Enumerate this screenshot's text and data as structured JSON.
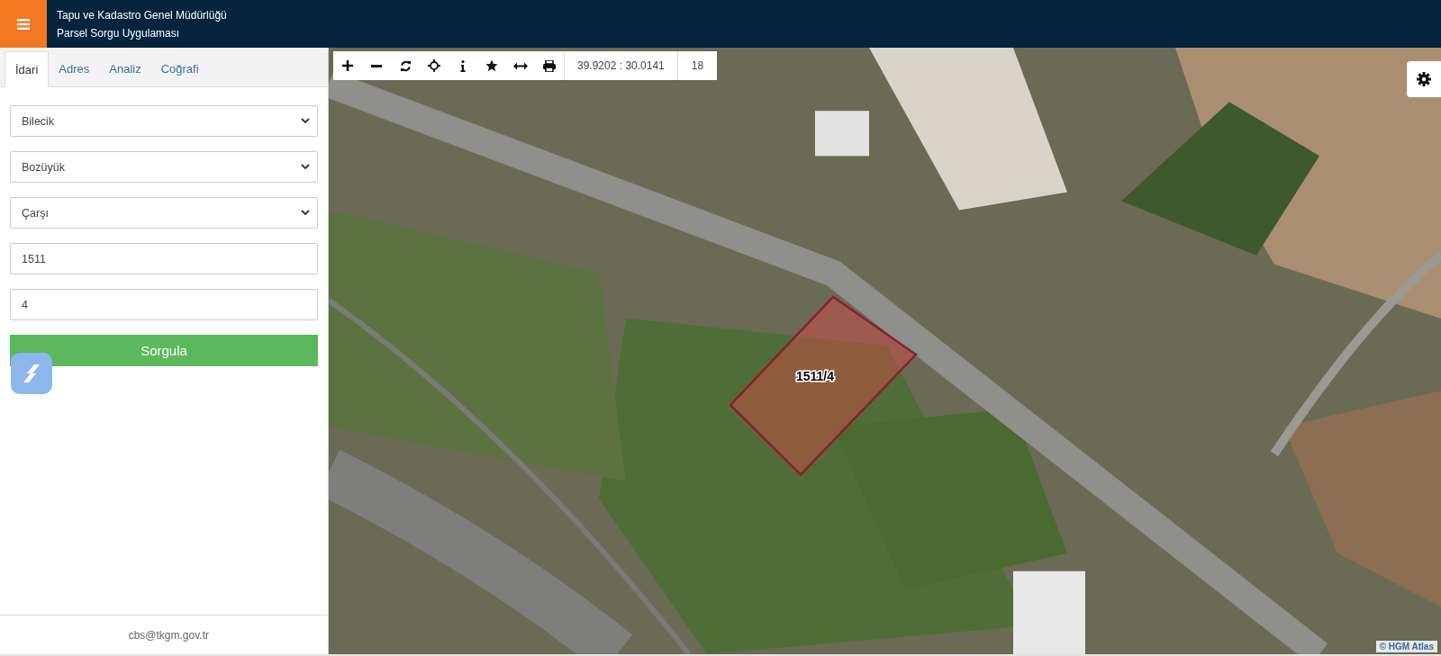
{
  "header": {
    "title": "Tapu ve Kadastro Genel Müdürlüğü",
    "subtitle": "Parsel Sorgu Uygulaması"
  },
  "tabs": [
    {
      "label": "İdari",
      "selected": true
    },
    {
      "label": "Adres",
      "selected": false
    },
    {
      "label": "Analiz",
      "selected": false
    },
    {
      "label": "Coğrafi",
      "selected": false
    }
  ],
  "form_fields": [
    {
      "kind": "select",
      "value": "Bilecik"
    },
    {
      "kind": "select",
      "value": "Bozüyük"
    },
    {
      "kind": "select",
      "value": "Çarşı"
    },
    {
      "kind": "input",
      "value": "1511"
    },
    {
      "kind": "input",
      "value": "4"
    }
  ],
  "query_button": "Sorgula",
  "footer": {
    "email": "cbs@tkgm.gov.tr"
  },
  "map": {
    "toolbar": {
      "tools": [
        {
          "kind": "zoom-in"
        },
        {
          "kind": "zoom-out"
        },
        {
          "kind": "refresh"
        },
        {
          "kind": "locate"
        },
        {
          "kind": "info"
        },
        {
          "kind": "favorite"
        },
        {
          "kind": "measure"
        },
        {
          "kind": "print"
        }
      ],
      "coordinates": "39.9202 : 30.0141",
      "zoom_level": "18"
    },
    "parcel_label": "1511/4",
    "attribution": "© HGM Atlas"
  }
}
